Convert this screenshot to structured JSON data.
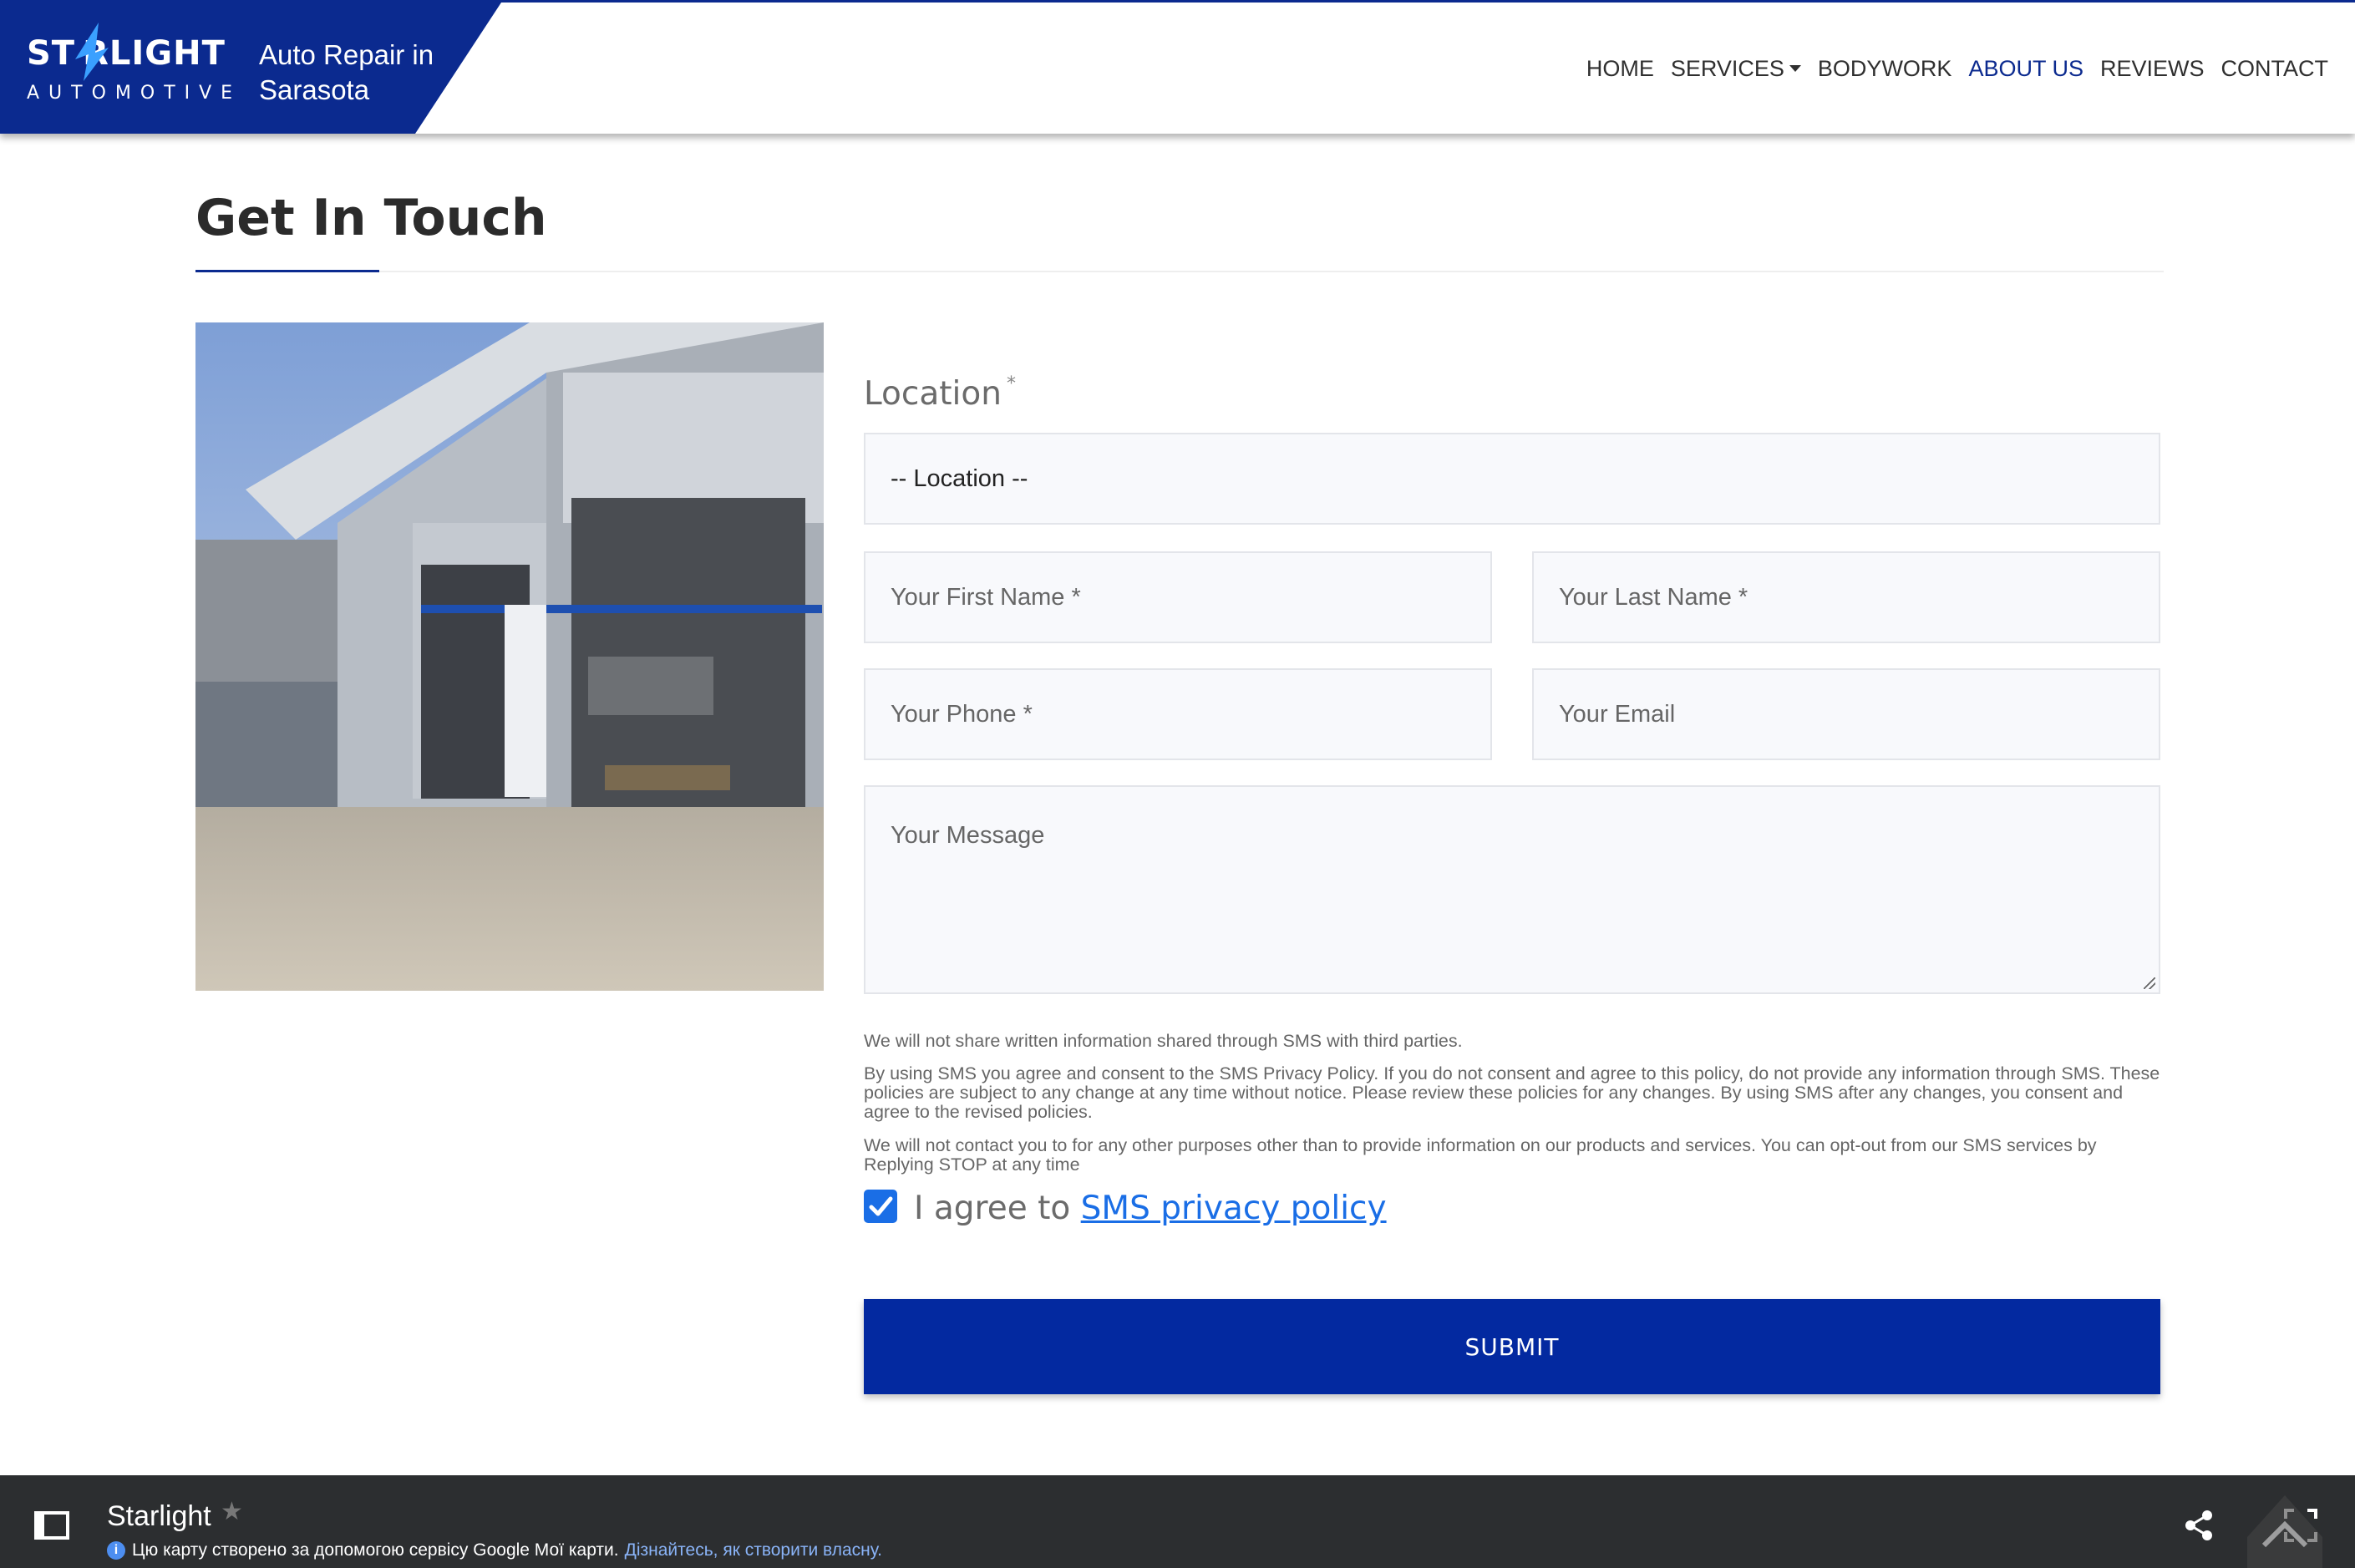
{
  "header": {
    "logo_main": "ST RLIGHT",
    "logo_sub": "AUTOMOTIVE",
    "tagline": "Auto Repair in Sarasota",
    "nav": {
      "home": "HOME",
      "services": "SERVICES",
      "bodywork": "BODYWORK",
      "about": "ABOUT US",
      "reviews": "REVIEWS",
      "contact": "CONTACT"
    }
  },
  "colors": {
    "brand": "#0b2a8f",
    "submit": "#0329a0",
    "link": "#1a6ee6",
    "map_bar": "#2c2e30"
  },
  "page": {
    "title": "Get In Touch"
  },
  "form": {
    "location_label": "Location",
    "required_mark": "*",
    "location_select_value": "-- Location --",
    "first_name_placeholder": "Your First Name *",
    "last_name_placeholder": "Your Last Name *",
    "phone_placeholder": "Your Phone *",
    "email_placeholder": "Your Email",
    "message_placeholder": "Your Message",
    "sms_note_1": "We will not share written information shared through SMS with third parties.",
    "sms_note_2": "By using SMS you agree and consent to the SMS Privacy Policy. If you do not consent and agree to this policy, do not provide any information through SMS. These policies are subject to any change at any time without notice. Please review these policies for any changes. By using SMS after any changes, you consent and agree to the revised policies.",
    "sms_note_3": "We will not contact you to for any other purposes other than to provide information on our products and services. You can opt-out from our SMS services by Replying STOP at any time",
    "agree_prefix": "I agree to ",
    "agree_link": "SMS privacy policy",
    "agree_checked": true,
    "submit_label": "SUBMIT"
  },
  "map_bar": {
    "title": "Starlight",
    "info_text": "Цю карту створено за допомогою сервісу Google Мої карти.",
    "learn_link": "Дізнайтесь, як створити власну.",
    "icons": [
      "sidebar-toggle-icon",
      "star-icon",
      "info-icon",
      "share-icon",
      "fullscreen-icon",
      "scroll-top-icon"
    ]
  }
}
